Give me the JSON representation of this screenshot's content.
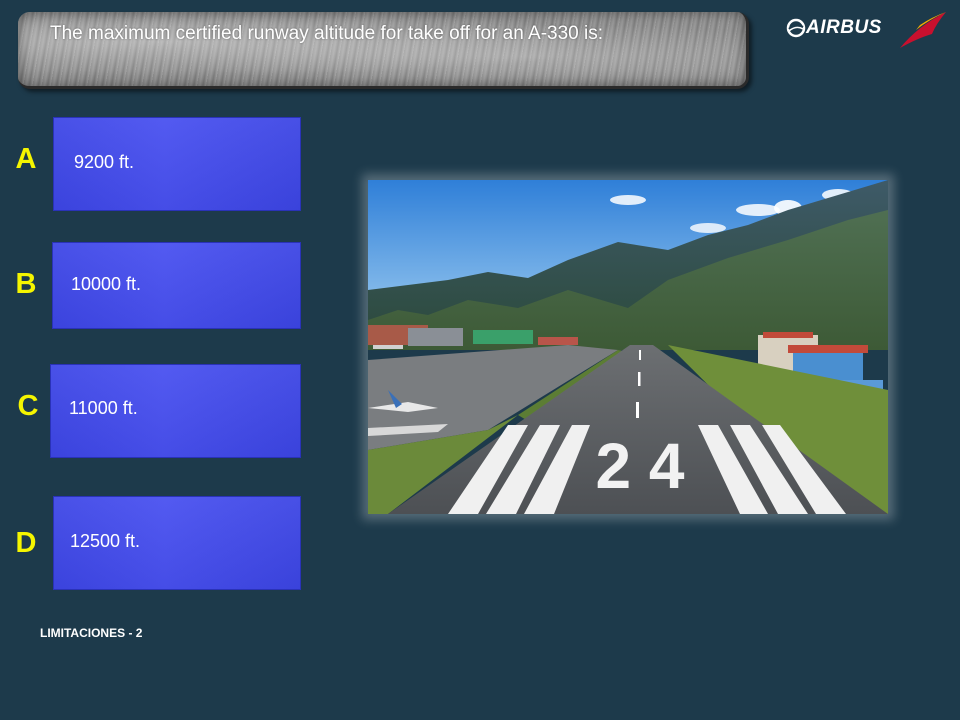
{
  "question": {
    "text": "The maximum certified runway altitude for take off for an A-330 is:"
  },
  "logo": {
    "text": "AIRBUS",
    "icon": "airbus-logo-icon",
    "wing_icon": "airline-wing-logo-icon",
    "wing_colors": [
      "#c8102e",
      "#f5a800"
    ]
  },
  "answers": [
    {
      "letter": "A",
      "value": "9200 ft."
    },
    {
      "letter": "B",
      "value": "10000 ft."
    },
    {
      "letter": "C",
      "value": "11000 ft."
    },
    {
      "letter": "D",
      "value": "12500 ft."
    }
  ],
  "photo": {
    "runway_marking": "2 4"
  },
  "footer": {
    "label": "LIMITACIONES - 2"
  },
  "colors": {
    "background": "#1d3a4b",
    "answer_box": "#4149ea",
    "letter": "#f5f500"
  }
}
